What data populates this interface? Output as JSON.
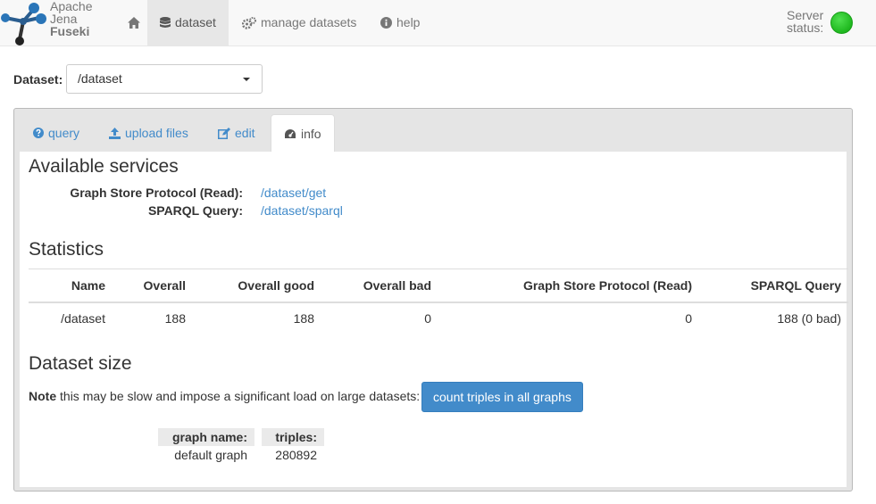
{
  "brand": {
    "line1": "Apache",
    "line2": "Jena",
    "line3": "Fuseki"
  },
  "nav": {
    "home_icon": "home-icon",
    "dataset": "dataset",
    "manage": "manage datasets",
    "help": "help",
    "server_status_line1": "Server",
    "server_status_line2": "status:",
    "server_status_color": "#22c022"
  },
  "dataset_selector": {
    "label": "Dataset:",
    "value": "/dataset"
  },
  "tabs": [
    {
      "label": "query",
      "icon": "question-circle-icon"
    },
    {
      "label": "upload files",
      "icon": "upload-icon"
    },
    {
      "label": "edit",
      "icon": "edit-icon"
    },
    {
      "label": "info",
      "icon": "dashboard-icon",
      "active": true
    }
  ],
  "services": {
    "heading": "Available services",
    "items": [
      {
        "label": "Graph Store Protocol (Read):",
        "link": "/dataset/get"
      },
      {
        "label": "SPARQL Query:",
        "link": "/dataset/sparql"
      }
    ]
  },
  "statistics": {
    "heading": "Statistics",
    "columns": [
      "Name",
      "Overall",
      "Overall good",
      "Overall bad",
      "Graph Store Protocol (Read)",
      "SPARQL Query"
    ],
    "rows": [
      [
        "/dataset",
        "188",
        "188",
        "0",
        "0",
        "188 (0 bad)"
      ]
    ]
  },
  "dataset_size": {
    "heading": "Dataset size",
    "note_bold": "Note",
    "note_text": " this may be slow and impose a significant load on large datasets:",
    "button": "count triples in all graphs",
    "col_graph": "graph name:",
    "col_triples": "triples:",
    "graph_name": "default graph",
    "triples": "280892"
  }
}
